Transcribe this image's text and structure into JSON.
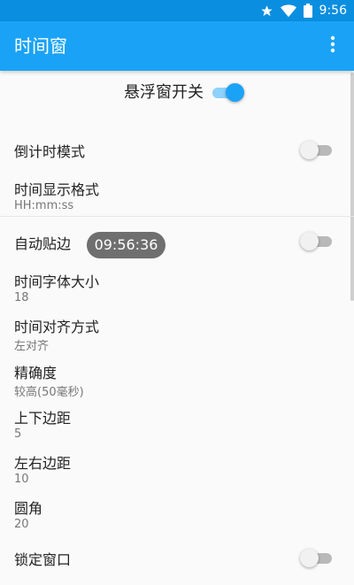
{
  "status_bar": {
    "time": "9:56",
    "icons": [
      "star-icon",
      "wifi-icon",
      "battery-icon"
    ]
  },
  "app_bar": {
    "title": "时间窗",
    "overflow_icon": "more-vert-icon"
  },
  "master_switch": {
    "label": "悬浮窗开关",
    "on": true
  },
  "preferences": [
    {
      "title": "倒计时模式",
      "type": "switch",
      "on": false
    },
    {
      "title": "时间显示格式",
      "summary": "HH:mm:ss"
    },
    {
      "title": "自动贴边",
      "type": "switch",
      "on": false
    },
    {
      "title": "时间字体大小",
      "summary": "18"
    },
    {
      "title": "时间对齐方式",
      "summary": "左对齐"
    },
    {
      "title": "精确度",
      "summary": "较高(50毫秒)"
    },
    {
      "title": "上下边距",
      "summary": "5"
    },
    {
      "title": "左右边距",
      "summary": "10"
    },
    {
      "title": "圆角",
      "summary": "20"
    },
    {
      "title": "锁定窗口",
      "type": "switch",
      "on": false
    }
  ],
  "floating_clock": {
    "time": "09:56:36"
  },
  "colors": {
    "status_bar": "#0a8ee0",
    "app_bar": "#1aa3f6",
    "accent": "#1aa3f6",
    "background": "#fafafa"
  }
}
